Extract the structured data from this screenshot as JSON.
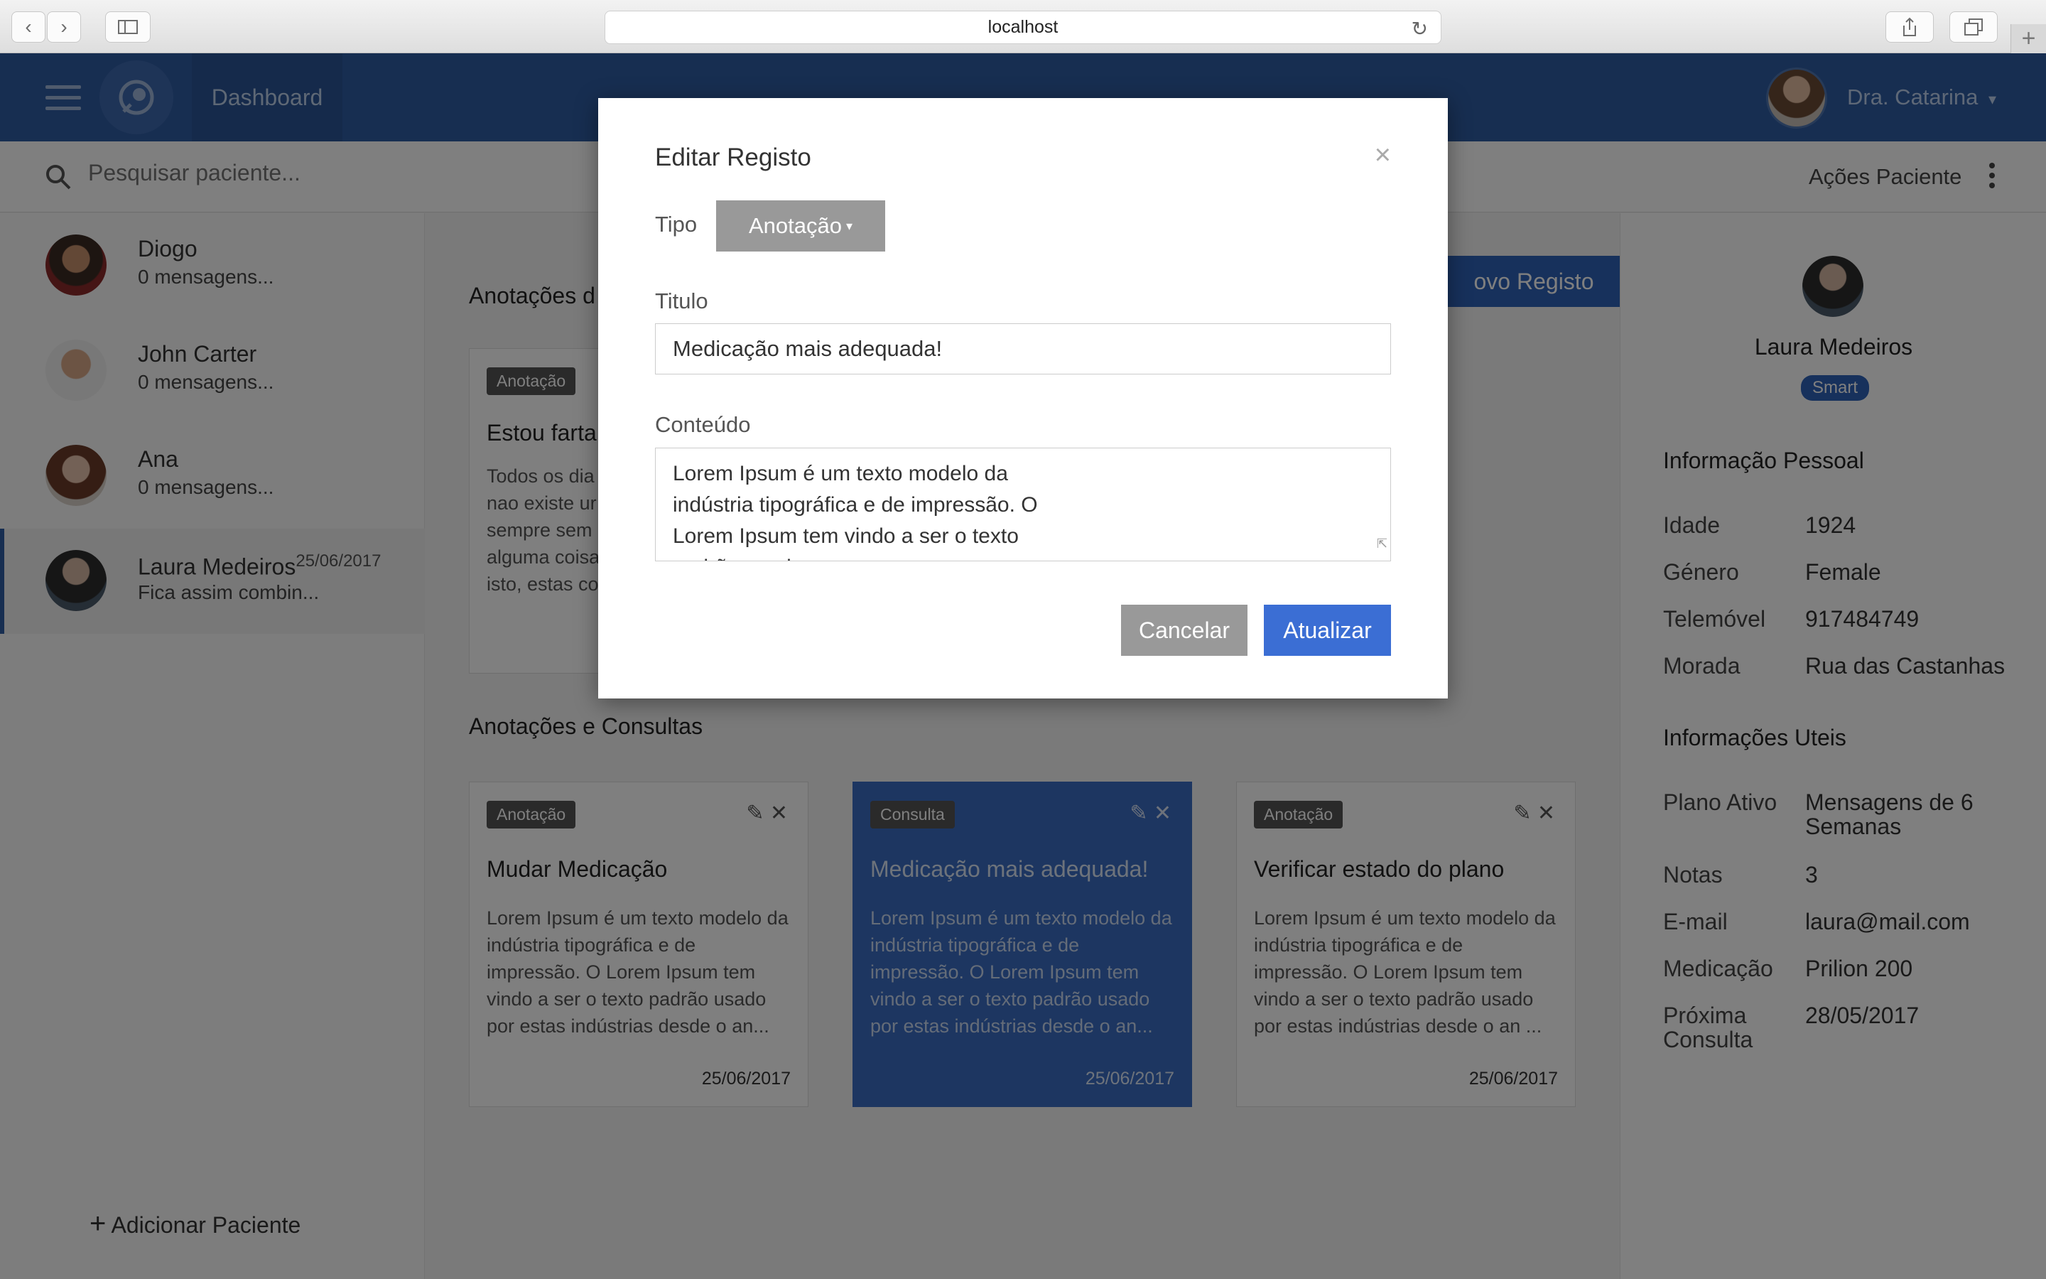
{
  "browser": {
    "url": "localhost",
    "back_icon": "chevron-left-icon",
    "forward_icon": "chevron-right-icon",
    "sidebar_icon": "sidebar-icon",
    "reload_icon": "reload-icon",
    "share_icon": "share-icon",
    "tabs_icon": "tabs-icon",
    "new_tab_icon": "plus-icon"
  },
  "header": {
    "menu_icon": "hamburger-icon",
    "logo_icon": "logo-icon",
    "dashboard_label": "Dashboard",
    "user_name": "Dra. Catarina",
    "user_caret": "▾",
    "accent_color": "#2f5ca3"
  },
  "subheader": {
    "search_placeholder": "Pesquisar paciente...",
    "patient_actions": "Ações Paciente"
  },
  "sidebar": {
    "patients": [
      {
        "name": "Diogo",
        "subtitle": "0 mensagens..."
      },
      {
        "name": "John Carter",
        "subtitle": "0 mensagens..."
      },
      {
        "name": "Ana",
        "subtitle": "0 mensagens..."
      },
      {
        "name": "Laura Medeiros",
        "subtitle": "Fica assim combin...",
        "date": "25/06/2017"
      }
    ],
    "add_patient": "Adicionar Paciente"
  },
  "main": {
    "featured_title": "Anotações d",
    "new_record_label": "ovo Registo",
    "featured_card": {
      "badge": "Anotação",
      "title": "Estou farta",
      "body": "Todos os dia nao existe ur sempre sem alguma coisa isto, estas co"
    },
    "list_title": "Anotações e Consultas",
    "cards": [
      {
        "badge": "Anotação",
        "title": "Mudar Medicação",
        "body": "Lorem Ipsum é um texto modelo da indústria tipográfica e de impressão. O Lorem Ipsum tem vindo a ser o texto padrão usado por estas indústrias desde o an...",
        "date": "25/06/2017"
      },
      {
        "badge": "Consulta",
        "title": "Medicação mais adequada!",
        "body": "Lorem Ipsum é um texto modelo da indústria tipográfica e de impressão. O Lorem Ipsum tem vindo a ser o texto padrão usado por estas indústrias desde o an...",
        "date": "25/06/2017"
      },
      {
        "badge": "Anotação",
        "title": "Verificar estado do plano",
        "body": "Lorem Ipsum é um texto modelo da indústria tipográfica e de impressão. O Lorem Ipsum tem vindo a ser o texto padrão usado por estas indústrias desde o an ...",
        "date": "25/06/2017"
      }
    ]
  },
  "patient_panel": {
    "name": "Laura Medeiros",
    "badge": "Smart",
    "personal_title": "Informação Pessoal",
    "personal": [
      {
        "label": "Idade",
        "value": "1924"
      },
      {
        "label": "Género",
        "value": "Female"
      },
      {
        "label": "Telemóvel",
        "value": "917484749"
      },
      {
        "label": "Morada",
        "value": "Rua das Castanhas"
      }
    ],
    "useful_title": "Informações Uteis",
    "useful": [
      {
        "label": "Plano Ativo",
        "value": "Mensagens de 6 Semanas"
      },
      {
        "label": "Notas",
        "value": "3"
      },
      {
        "label": "E-mail",
        "value": "laura@mail.com"
      },
      {
        "label": "Medicação",
        "value": "Prilion 200"
      },
      {
        "label": "Próxima Consulta",
        "value": "28/05/2017"
      }
    ]
  },
  "modal": {
    "title": "Editar Registo",
    "close": "×",
    "type_label": "Tipo",
    "type_value": "Anotação",
    "type_caret": "▾",
    "title_label": "Titulo",
    "title_value": "Medicação mais adequada!",
    "content_label": "Conteúdo",
    "content_value": "Lorem Ipsum é um texto modelo da indústria tipográfica e de impressão. O Lorem Ipsum tem vindo a ser o texto padrão usado",
    "cancel_label": "Cancelar",
    "update_label": "Atualizar"
  }
}
